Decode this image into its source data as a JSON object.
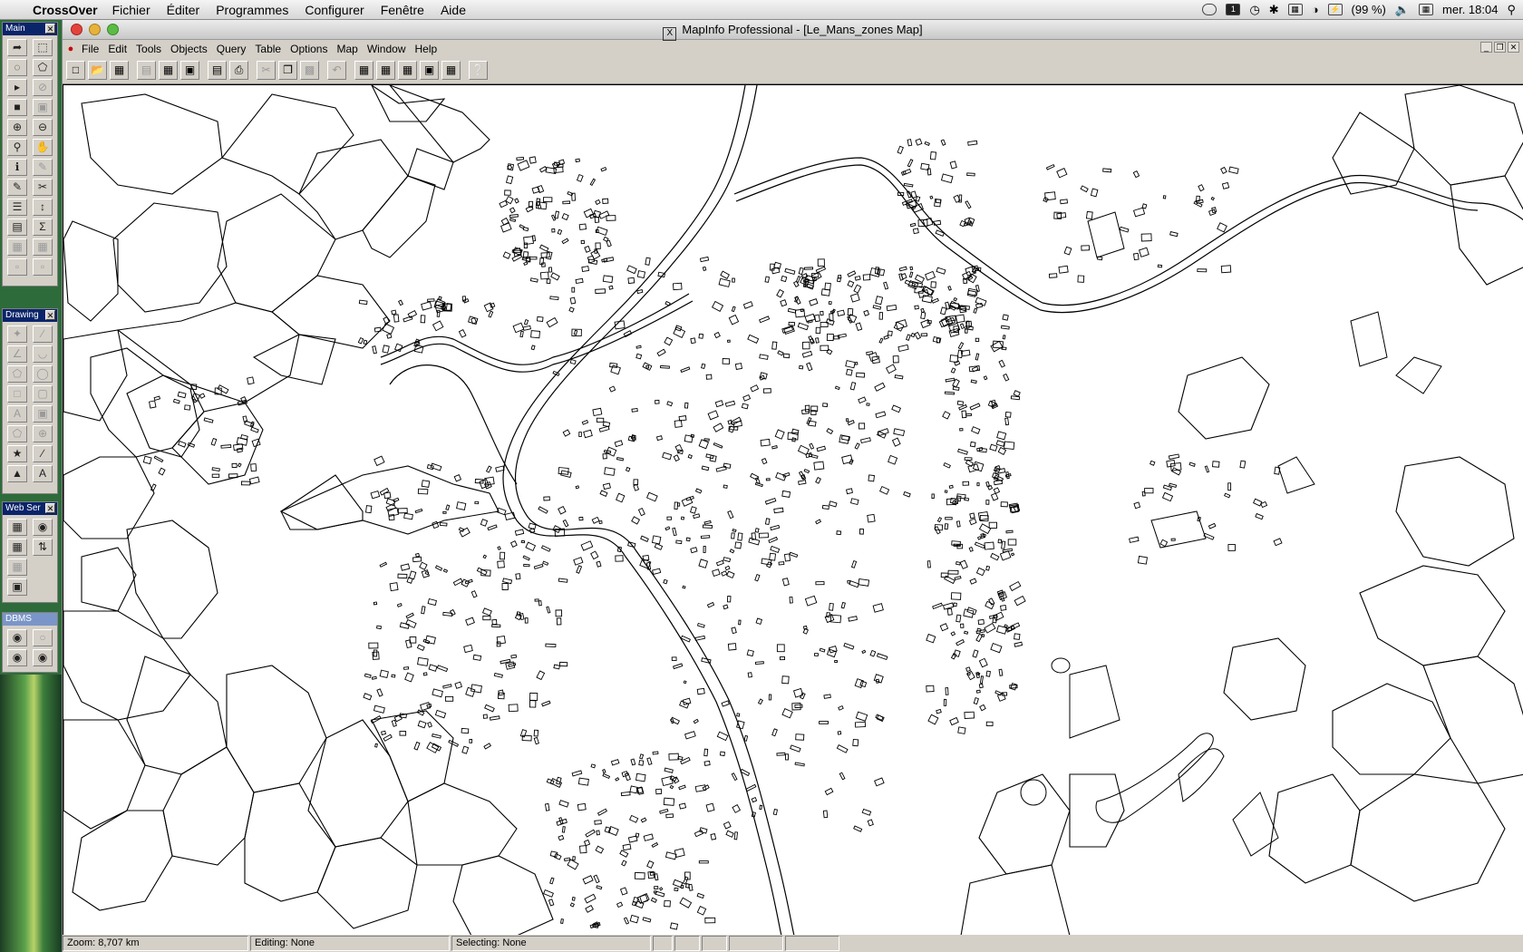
{
  "mac_menubar": {
    "app_name": "CrossOver",
    "menus": [
      "Fichier",
      "Éditer",
      "Programmes",
      "Configurer",
      "Fenêtre",
      "Aide"
    ],
    "battery": "(99 %)",
    "clock": "mer. 18:04"
  },
  "window": {
    "title": "MapInfo Professional - [Le_Mans_zones Map]",
    "menus": [
      {
        "label": "File"
      },
      {
        "label": "Edit"
      },
      {
        "label": "Tools"
      },
      {
        "label": "Objects"
      },
      {
        "label": "Query"
      },
      {
        "label": "Table"
      },
      {
        "label": "Options"
      },
      {
        "label": "Map"
      },
      {
        "label": "Window"
      },
      {
        "label": "Help"
      }
    ]
  },
  "palettes": {
    "main": {
      "title": "Main"
    },
    "drawing": {
      "title": "Drawing"
    },
    "web": {
      "title": "Web Ser"
    },
    "dbms": {
      "title": "DBMS"
    }
  },
  "status": {
    "zoom": "Zoom: 8,707 km",
    "editing": "Editing: None",
    "selecting": "Selecting: None"
  },
  "icons": {
    "select": "arrow-icon",
    "zoom_in": "zoom-in-icon",
    "zoom_out": "zoom-out-icon",
    "pan": "hand-icon",
    "info": "info-icon",
    "ruler": "ruler-icon",
    "layer_control": "layers-icon",
    "new": "new-document-icon",
    "open": "open-folder-icon",
    "save": "save-icon",
    "print": "print-icon",
    "cut": "cut-icon",
    "copy": "copy-icon",
    "paste": "paste-icon",
    "undo": "undo-icon",
    "help": "help-pointer-icon"
  }
}
